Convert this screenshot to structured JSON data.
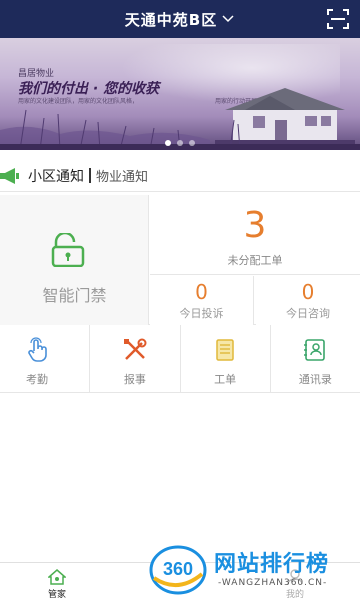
{
  "header": {
    "title": "天通中苑B区",
    "title_icon": "chevron-down-icon",
    "scan_icon": "scan-icon"
  },
  "banner": {
    "company": "昌居物业",
    "slogan": "我们的付出 · 您的收获",
    "sub_left": "用家的文化建设团队，用家的文化团队风格，",
    "sub_right": "用家的行动开展团队！",
    "dots": 3,
    "active_dot": 0
  },
  "notice": {
    "title": "小区通知",
    "subtitle": "物业通知",
    "icon": "megaphone-icon"
  },
  "door": {
    "label": "智能门禁",
    "icon": "unlock-icon"
  },
  "stats": {
    "pending": {
      "value": "3",
      "label": "未分配工单"
    },
    "complaints": {
      "value": "0",
      "label": "今日投诉"
    },
    "consult": {
      "value": "0",
      "label": "今日咨询"
    }
  },
  "functions": [
    {
      "label": "考勤",
      "icon": "hand-tap-icon"
    },
    {
      "label": "报事",
      "icon": "tools-icon"
    },
    {
      "label": "工单",
      "icon": "document-icon"
    },
    {
      "label": "通讯录",
      "icon": "contacts-icon"
    }
  ],
  "tabbar": {
    "home_label": "管家",
    "mine_label": "我的"
  },
  "watermark": {
    "logo_text": "360",
    "main": "网站排行榜",
    "url": "-WANGZHAN360.CN-"
  },
  "colors": {
    "header": "#1e2a5a",
    "accent": "#e67e2e",
    "green": "#4caf50"
  }
}
